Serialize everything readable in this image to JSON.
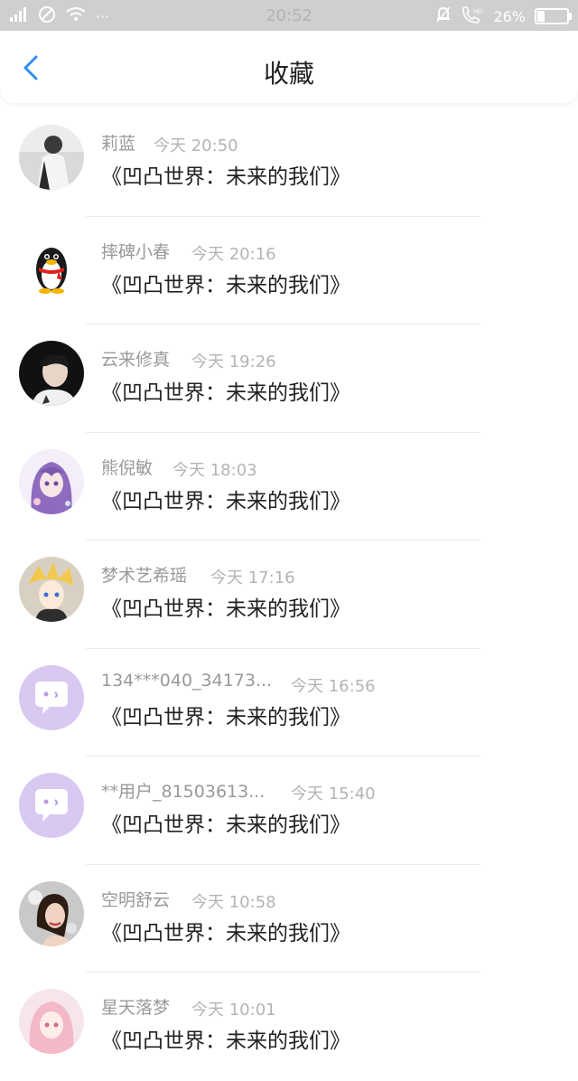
{
  "status_bar": {
    "signal_icon": "signal-icon",
    "dnd_icon": "block-icon",
    "wifi_icon": "wifi-icon",
    "more": "···",
    "time": "20:52",
    "bell_icon": "bell-muted-icon",
    "hd_call_icon": "hd-call-icon",
    "battery": "26%",
    "battery_level": 0.26
  },
  "header": {
    "title": "收藏",
    "back_icon": "chevron-left-icon",
    "accent": "#2f8ff0"
  },
  "items": [
    {
      "name": "莉蓝",
      "time": "今天 20:50",
      "message": "《凹凸世界：未来的我们》",
      "avatar": "photo-girl-avatar"
    },
    {
      "name": "摔碑小春",
      "time": "今天 20:16",
      "message": "《凹凸世界：未来的我们》",
      "avatar": "penguin-avatar"
    },
    {
      "name": "云来修真",
      "time": "今天 19:26",
      "message": "《凹凸世界：未来的我们》",
      "avatar": "photo-boy-avatar"
    },
    {
      "name": "熊倪敏",
      "time": "今天 18:03",
      "message": "《凹凸世界：未来的我们》",
      "avatar": "anime-purple-avatar"
    },
    {
      "name": "梦术艺希瑶",
      "time": "今天 17:16",
      "message": "《凹凸世界：未来的我们》",
      "avatar": "anime-blonde-avatar"
    },
    {
      "name": "134***040_34173...",
      "time": "今天 16:56",
      "message": "《凹凸世界：未来的我们》",
      "avatar": "default-chat-avatar"
    },
    {
      "name": "**用户_81503613...",
      "time": "今天 15:40",
      "message": "《凹凸世界：未来的我们》",
      "avatar": "default-chat-avatar"
    },
    {
      "name": "空明舒云",
      "time": "今天 10:58",
      "message": "《凹凸世界：未来的我们》",
      "avatar": "photo-woman-avatar"
    },
    {
      "name": "星天落梦",
      "time": "今天 10:01",
      "message": "《凹凸世界：未来的我们》",
      "avatar": "anime-pink-avatar"
    }
  ]
}
